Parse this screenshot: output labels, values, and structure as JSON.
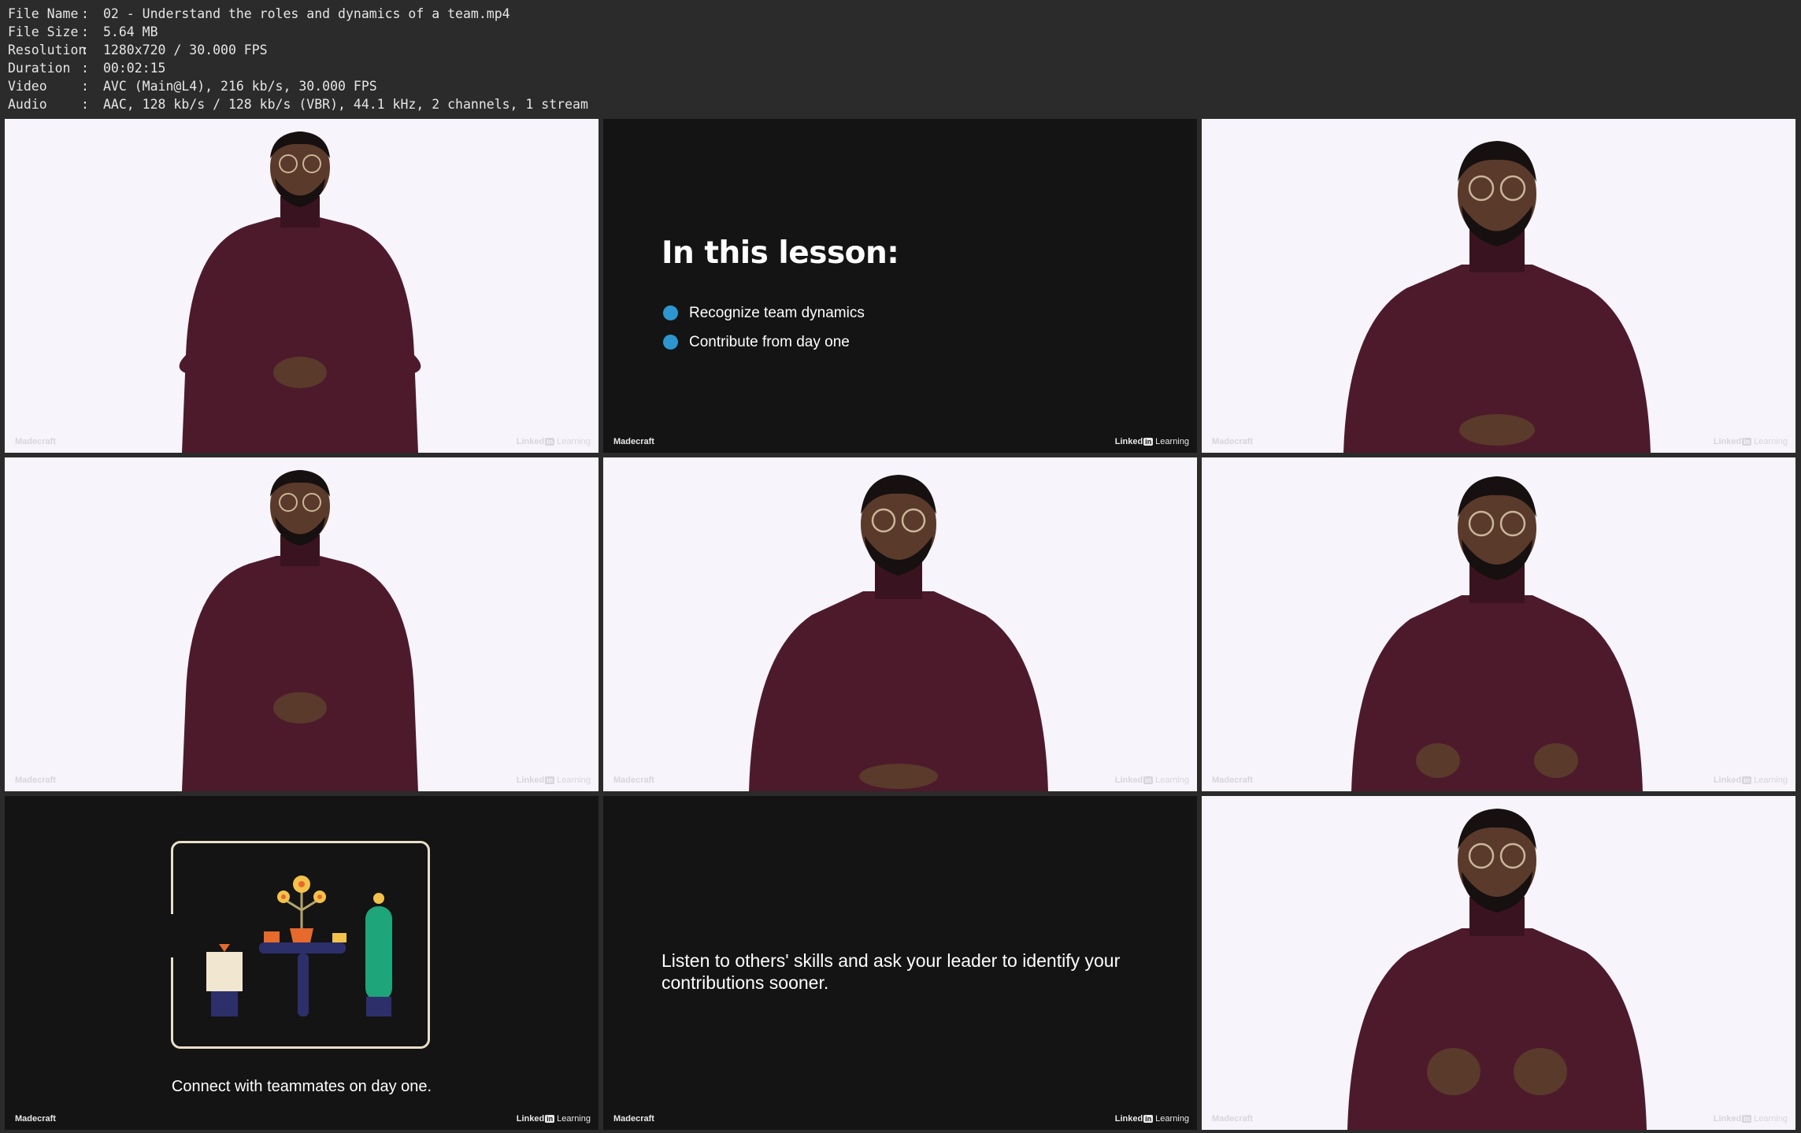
{
  "file_info": {
    "rows": [
      {
        "key": "File Name",
        "sep": ":",
        "value": "02 - Understand the roles and dynamics of a team.mp4"
      },
      {
        "key": "File Size",
        "sep": ":",
        "value": "5.64 MB"
      },
      {
        "key": "Resolution",
        "sep": ":",
        "value": "1280x720 / 30.000 FPS"
      },
      {
        "key": "Duration",
        "sep": ":",
        "value": "00:02:15"
      },
      {
        "key": "Video",
        "sep": ":",
        "value": "AVC (Main@L4), 216 kb/s, 30.000 FPS"
      },
      {
        "key": "Audio",
        "sep": ":",
        "value": "AAC, 128 kb/s / 128 kb/s (VBR), 44.1 kHz, 2 channels, 1 stream"
      }
    ]
  },
  "watermark": {
    "left": "Madecraft",
    "right_linked": "Linked",
    "right_in": "in",
    "right_learning": "Learning"
  },
  "lesson_slide": {
    "title": "In this lesson:",
    "bullets": [
      "Recognize team dynamics",
      "Contribute from day one"
    ]
  },
  "illustration_slide": {
    "caption": "Connect with teammates on day one."
  },
  "quote_slide": {
    "text": "Listen to others' skills and ask your leader to identify your contributions sooner."
  },
  "colors": {
    "background": "#2b2b2b",
    "slide_dark": "#141414",
    "studio_white": "#f7f4fb",
    "sweater": "#4d1a2c",
    "bullet_blue": "#2d96d0",
    "frame_cream": "#e9dfc8"
  }
}
